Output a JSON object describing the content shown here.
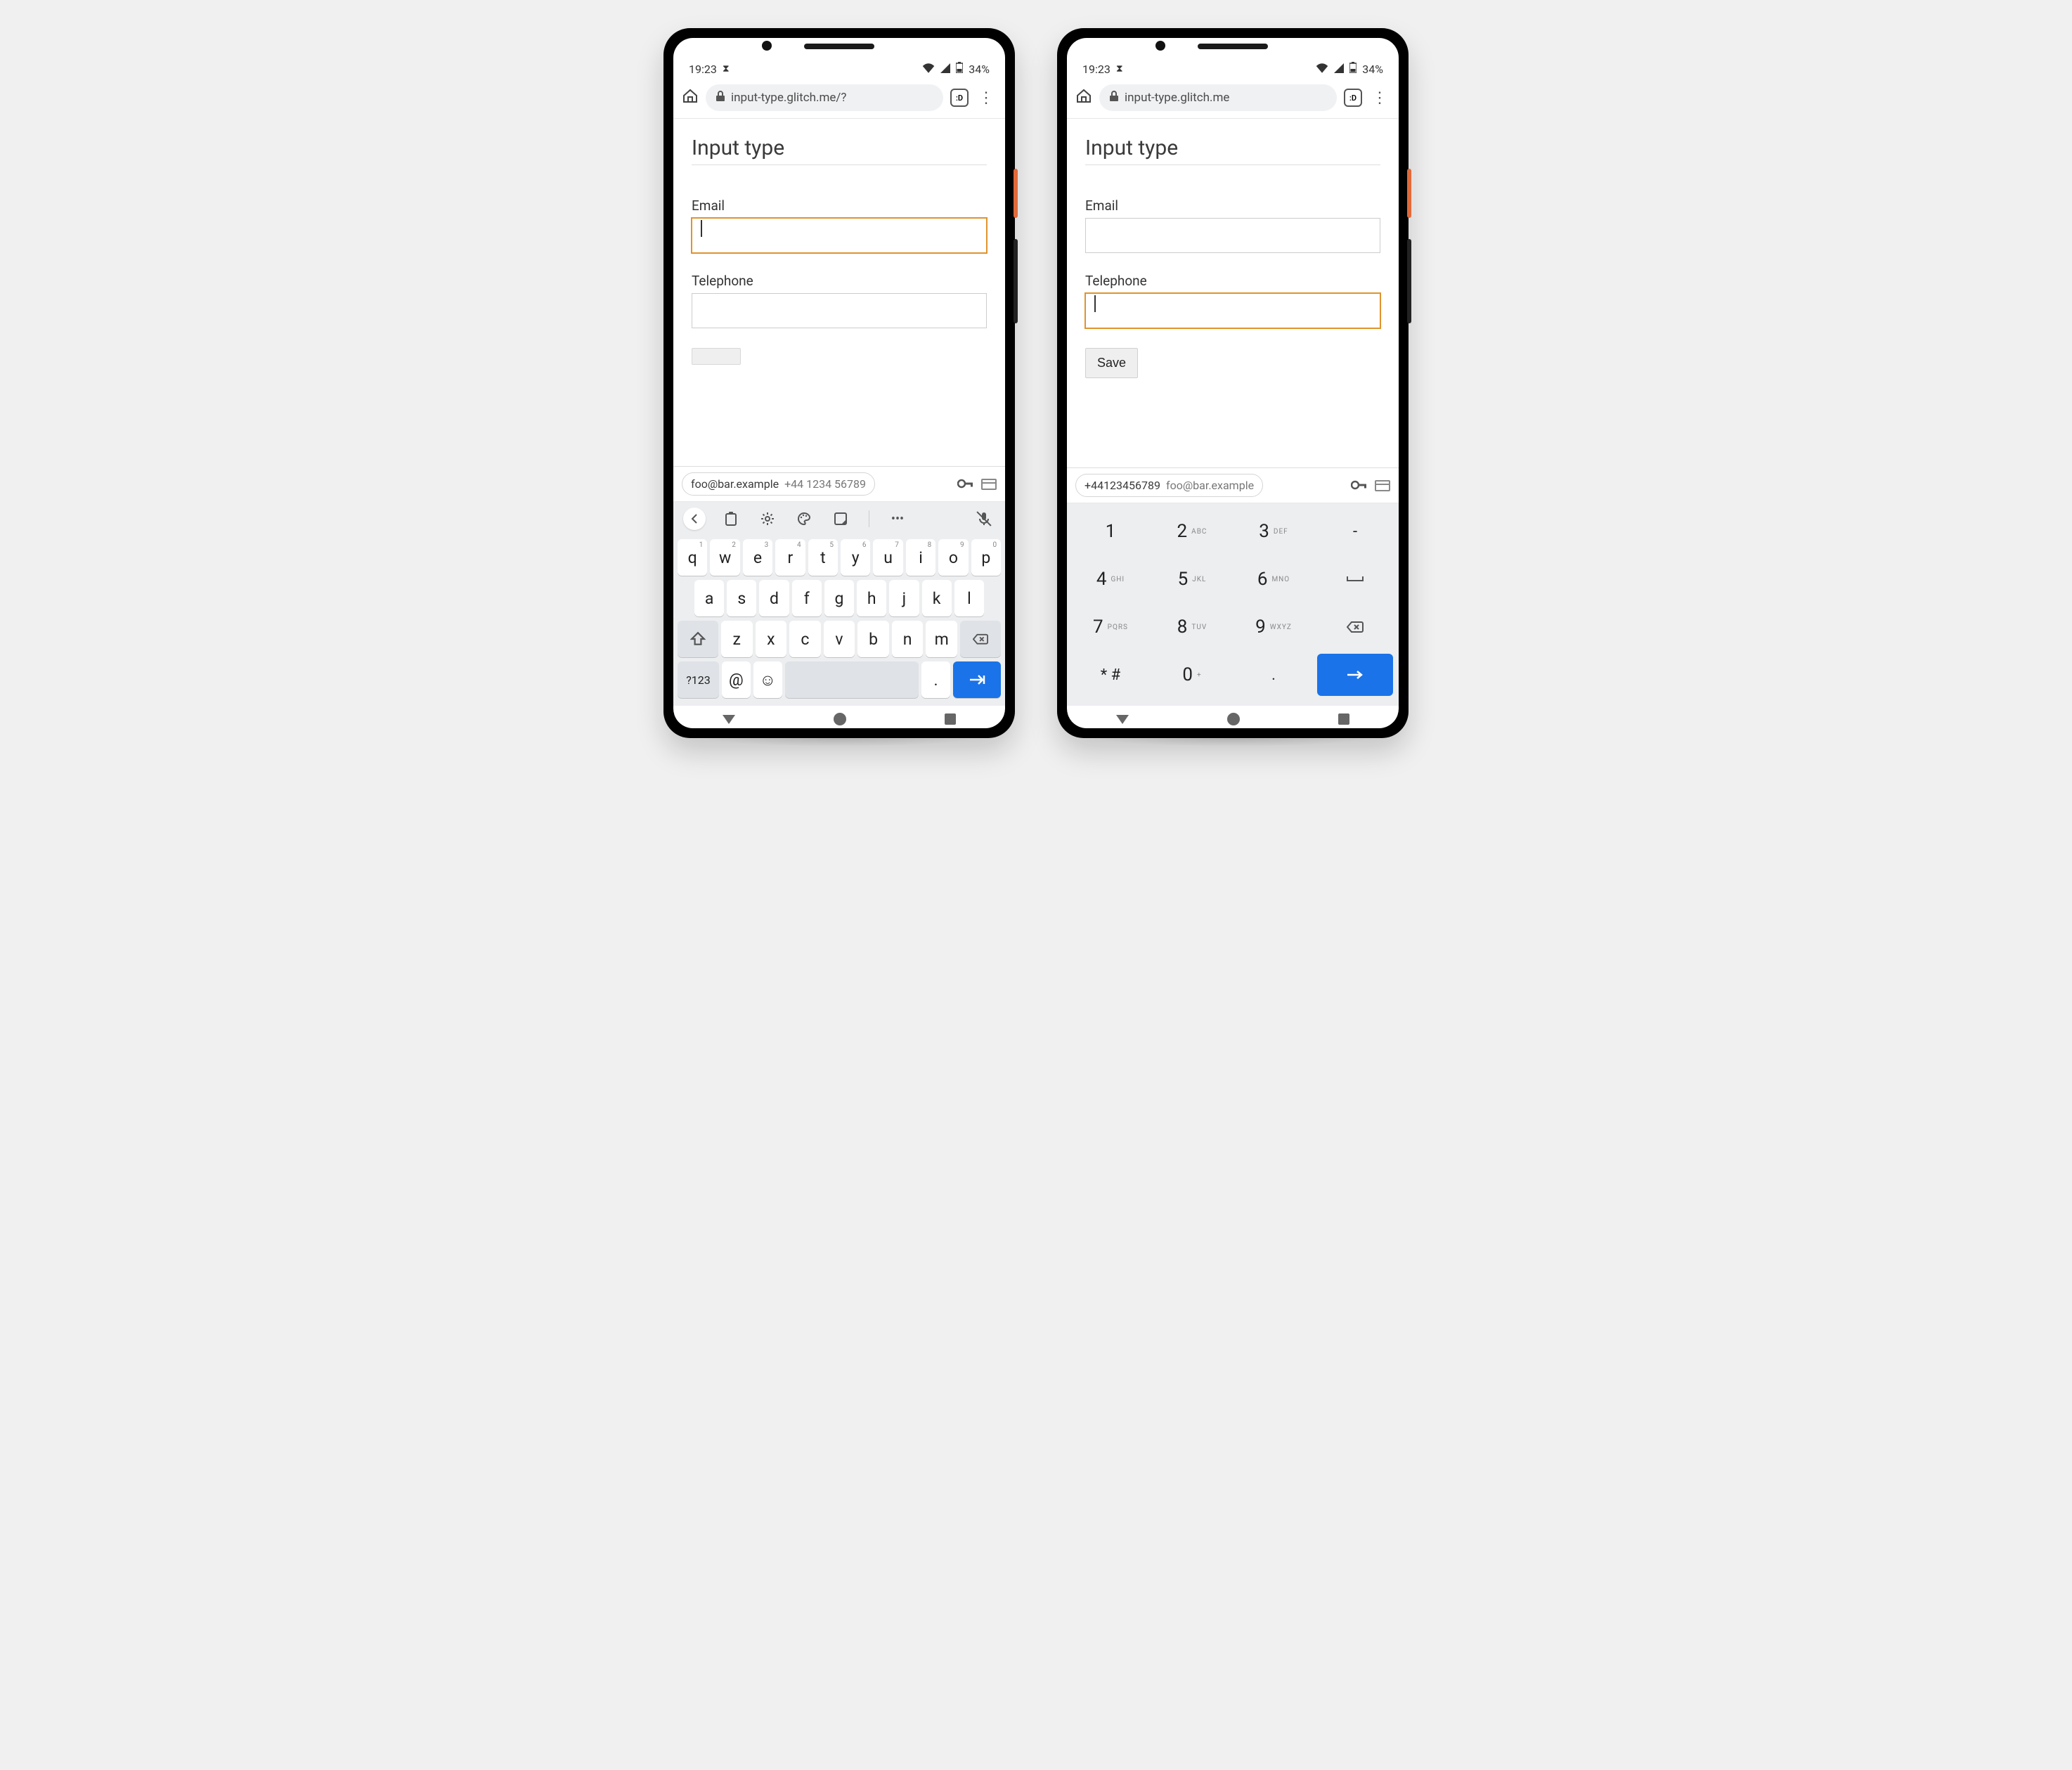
{
  "status": {
    "time": "19:23",
    "battery": "34%"
  },
  "omnibox": {
    "left_url": "input-type.glitch.me/?",
    "right_url": "input-type.glitch.me",
    "tabs_badge": ":D"
  },
  "page": {
    "title": "Input type",
    "email_label": "Email",
    "tel_label": "Telephone",
    "save_label": "Save"
  },
  "autofill": {
    "email": "foo@bar.example",
    "phone": "+44 1234 56789",
    "phone_compact": "+44123456789"
  },
  "qwerty": {
    "row1": [
      {
        "k": "q",
        "n": "1"
      },
      {
        "k": "w",
        "n": "2"
      },
      {
        "k": "e",
        "n": "3"
      },
      {
        "k": "r",
        "n": "4"
      },
      {
        "k": "t",
        "n": "5"
      },
      {
        "k": "y",
        "n": "6"
      },
      {
        "k": "u",
        "n": "7"
      },
      {
        "k": "i",
        "n": "8"
      },
      {
        "k": "o",
        "n": "9"
      },
      {
        "k": "p",
        "n": "0"
      }
    ],
    "row2": [
      "a",
      "s",
      "d",
      "f",
      "g",
      "h",
      "j",
      "k",
      "l"
    ],
    "row3": [
      "z",
      "x",
      "c",
      "v",
      "b",
      "n",
      "m"
    ],
    "symkey": "?123",
    "at": "@",
    "dot": "."
  },
  "numpad": {
    "rows": [
      [
        {
          "k": "1"
        },
        {
          "k": "2",
          "s": "ABC"
        },
        {
          "k": "3",
          "s": "DEF"
        },
        {
          "k": "-",
          "sym": true
        }
      ],
      [
        {
          "k": "4",
          "s": "GHI"
        },
        {
          "k": "5",
          "s": "JKL"
        },
        {
          "k": "6",
          "s": "MNO"
        },
        {
          "k": "␣",
          "sym": true,
          "space": true
        }
      ],
      [
        {
          "k": "7",
          "s": "PQRS"
        },
        {
          "k": "8",
          "s": "TUV"
        },
        {
          "k": "9",
          "s": "WXYZ"
        },
        {
          "k": "bksp",
          "bksp": true
        }
      ],
      [
        {
          "k": "* #",
          "sym": true
        },
        {
          "k": "0",
          "s": "+"
        },
        {
          "k": ".",
          "sym": true
        },
        {
          "k": "enter",
          "enter": true
        }
      ]
    ]
  }
}
